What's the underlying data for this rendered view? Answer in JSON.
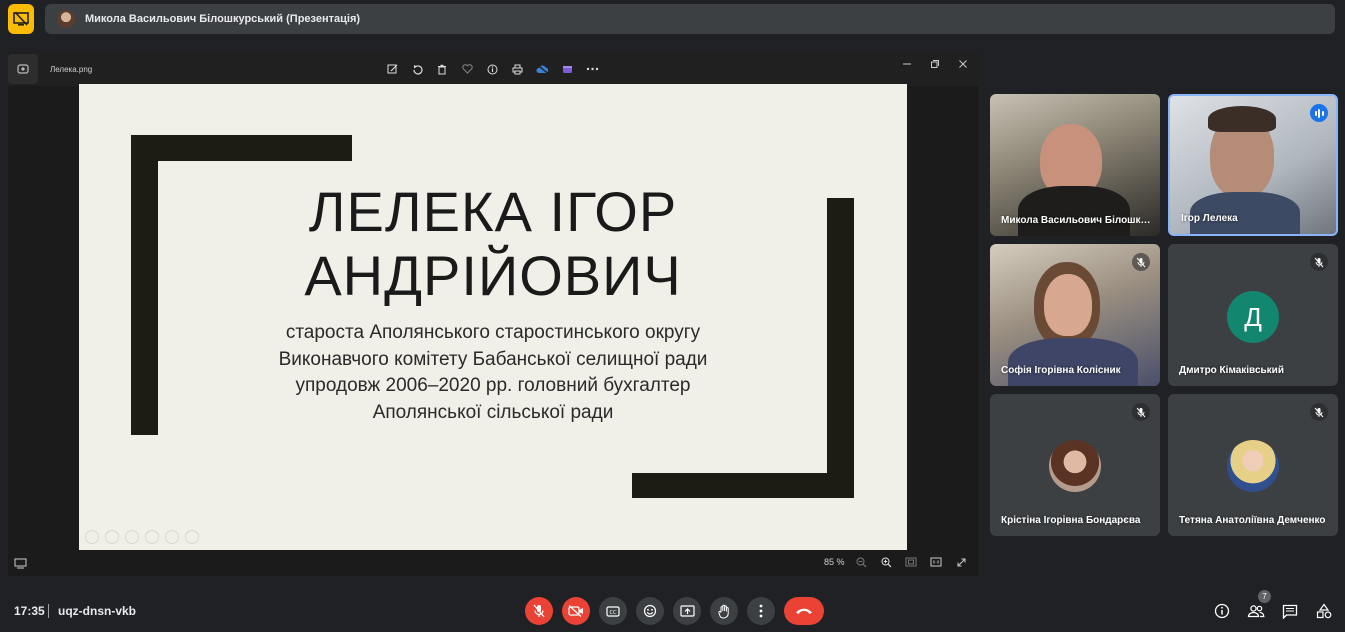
{
  "presenter_bar": {
    "title": "Микола Васильович Білошкурський (Презентація)"
  },
  "viewer": {
    "filename": "Лелека.png",
    "zoom": "85 %",
    "tools": [
      "edit-icon",
      "rotate-icon",
      "delete-icon",
      "heart-icon",
      "info-icon",
      "print-icon",
      "cloud-icon",
      "clipchamp-icon",
      "more-icon"
    ]
  },
  "slide": {
    "name_line1": "ЛЕЛЕКА ІГОР",
    "name_line2": "АНДРІЙОВИЧ",
    "desc_line1": "староста Аполянського старостинського округу",
    "desc_line2": "Виконавчого комітету Бабанської селищної ради",
    "desc_line3": "упродовж 2006–2020 рр. головний бухгалтер",
    "desc_line4": "Аполянської сільської ради"
  },
  "participants": [
    {
      "name": "Микола Васильович Білошкурський",
      "display": "Микола Васильович Білошку...",
      "muted": false,
      "type": "video"
    },
    {
      "name": "Ігор Лелека",
      "display": "Ігор Лелека",
      "muted": false,
      "speaking": true,
      "type": "video"
    },
    {
      "name": "Софія Ігорівна Колісник",
      "display": "Софія Ігорівна Колісник",
      "muted": true,
      "type": "video"
    },
    {
      "name": "Дмитро Кімаківський",
      "display": "Дмитро Кімаківський",
      "muted": true,
      "type": "letter",
      "letter": "Д"
    },
    {
      "name": "Крістіна Ігорівна Бондарєва",
      "display": "Крістіна Ігорівна Бондарєва",
      "muted": true,
      "type": "photo"
    },
    {
      "name": "Тетяна Анатоліївна Демченко",
      "display": "Тетяна Анатоліївна Демченко",
      "muted": true,
      "type": "photo"
    }
  ],
  "bottom_bar": {
    "time": "17:35",
    "meeting_code": "uqz-dnsn-vkb",
    "people_count": "7"
  },
  "colors": {
    "accent_red": "#ea4335",
    "present_yellow": "#fbbc04",
    "speaking_blue": "#1a73e8",
    "avatar_green": "#12866f"
  }
}
